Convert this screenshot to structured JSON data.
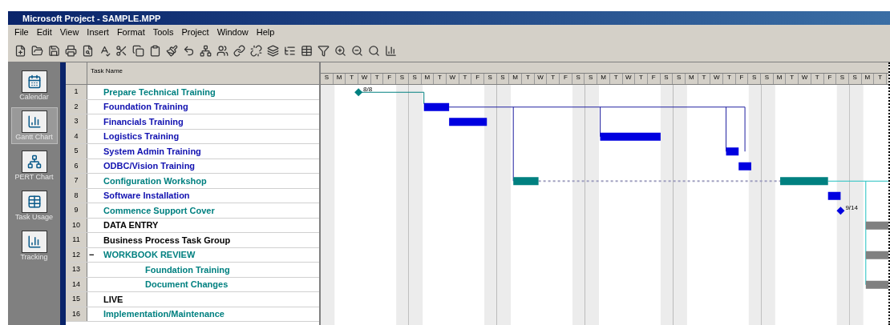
{
  "window": {
    "title": "Microsoft Project - SAMPLE.MPP"
  },
  "menu": [
    "File",
    "Edit",
    "View",
    "Insert",
    "Format",
    "Tools",
    "Project",
    "Window",
    "Help"
  ],
  "view_bar": [
    {
      "label": "Calendar",
      "selected": false
    },
    {
      "label": "Gantt Chart",
      "selected": true
    },
    {
      "label": "PERT Chart",
      "selected": false
    },
    {
      "label": "Task Usage",
      "selected": false
    },
    {
      "label": "Tracking",
      "selected": false
    }
  ],
  "table": {
    "columns": [
      "Task Name"
    ],
    "rows": [
      {
        "id": "1",
        "name": "Prepare Technical Training",
        "color": "#008080"
      },
      {
        "id": "2",
        "name": "Foundation Training",
        "color": "#1010b0"
      },
      {
        "id": "3",
        "name": "Financials Training",
        "color": "#1010b0"
      },
      {
        "id": "4",
        "name": "Logistics Training",
        "color": "#1010b0"
      },
      {
        "id": "5",
        "name": "System Admin Training",
        "color": "#1010b0"
      },
      {
        "id": "6",
        "name": "ODBC/Vision Training",
        "color": "#1010b0"
      },
      {
        "id": "7",
        "name": "Configuration Workshop",
        "color": "#008080"
      },
      {
        "id": "8",
        "name": "Software Installation",
        "color": "#1010b0"
      },
      {
        "id": "9",
        "name": "Commence Support Cover",
        "color": "#008080"
      },
      {
        "id": "10",
        "name": "DATA ENTRY",
        "color": "#000000"
      },
      {
        "id": "11",
        "name": "Business Process Task Group",
        "color": "#000000"
      },
      {
        "id": "12",
        "name": "WORKBOOK REVIEW",
        "color": "#008080",
        "toggle": "−",
        "expanded": true,
        "children": [
          {
            "id": "13",
            "name": "Foundation Training",
            "color": "#008080"
          },
          {
            "id": "14",
            "name": "Document Changes",
            "color": "#008080"
          }
        ]
      },
      {
        "id": "15",
        "name": "LIVE",
        "color": "#000000"
      },
      {
        "id": "16",
        "name": "Implementation/Maintenance",
        "color": "#008080"
      }
    ]
  },
  "timescale": {
    "weeks": [
      {
        "days": [
          "S",
          "M",
          "T",
          "W",
          "T",
          "F",
          "S"
        ]
      },
      {
        "days": [
          "S",
          "M",
          "T",
          "W",
          "T",
          "F",
          "S"
        ]
      },
      {
        "days": [
          "S",
          "M",
          "T",
          "W",
          "T",
          "F",
          "S"
        ]
      },
      {
        "days": [
          "S",
          "M",
          "T",
          "W",
          "T",
          "F",
          "S"
        ]
      },
      {
        "days": [
          "S",
          "M",
          "T",
          "W",
          "T",
          "F",
          "S"
        ]
      },
      {
        "days": [
          "S",
          "M",
          "T",
          "W",
          "T",
          "F",
          "S"
        ]
      },
      {
        "days": [
          "S",
          "M",
          "T"
        ]
      }
    ]
  },
  "milestones": [
    {
      "label": "8/8"
    },
    {
      "label": "9/14"
    }
  ]
}
